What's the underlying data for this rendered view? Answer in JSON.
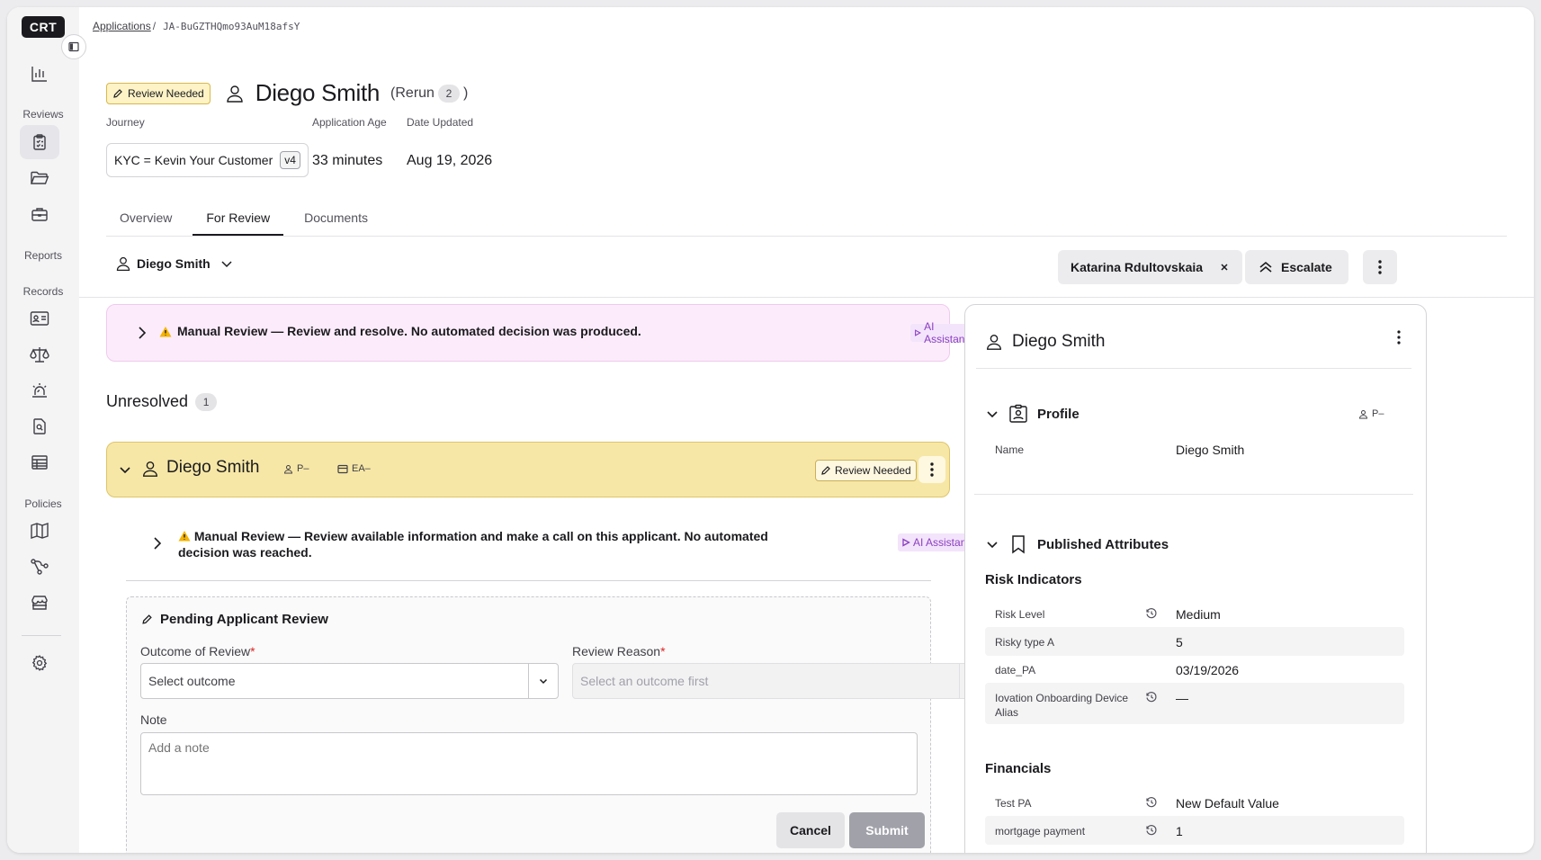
{
  "sidebar": {
    "logo": "CRT",
    "sections": {
      "reviews": "Reviews",
      "reports": "Reports",
      "records": "Records",
      "policies": "Policies"
    }
  },
  "breadcrumb": {
    "root": "Applications",
    "separator": "/",
    "id": "JA-BuGZTHQmo93AuM18afsY"
  },
  "header": {
    "status": "Review Needed",
    "name": "Diego Smith",
    "rerun_label": "(Rerun",
    "rerun_count": "2",
    "rerun_close": ")",
    "journey_label": "Journey",
    "journey_value": "KYC = Kevin Your Customer",
    "journey_version": "v4",
    "age_label": "Application Age",
    "age_value": "33 minutes",
    "updated_label": "Date Updated",
    "updated_value": "Aug 19, 2026"
  },
  "tabs": [
    "Overview",
    "For Review",
    "Documents"
  ],
  "toolbar": {
    "person": "Diego Smith",
    "assignee": "Katarina Rdultovskaia",
    "escalate": "Escalate"
  },
  "banner": {
    "text": "Manual Review — Review and resolve. No automated decision was produced.",
    "ai": "AI Assistant"
  },
  "unresolved": {
    "label": "Unresolved",
    "count": "1"
  },
  "card": {
    "name": "Diego Smith",
    "tag_person": "P–",
    "tag_entity": "EA–",
    "status": "Review Needed",
    "banner": "Manual Review — Review available information and make a call on this applicant. No automated decision was reached.",
    "ai": "AI Assistant"
  },
  "pending": {
    "title": "Pending Applicant Review",
    "outcome_label": "Outcome of Review",
    "outcome_placeholder": "Select outcome",
    "reason_label": "Review Reason",
    "reason_placeholder": "Select an outcome first",
    "required_mark": "*",
    "note_label": "Note",
    "note_placeholder": "Add a note",
    "cancel": "Cancel",
    "submit": "Submit"
  },
  "panel": {
    "name": "Diego Smith",
    "profile_title": "Profile",
    "profile_tag": "P–",
    "profile_rows": [
      {
        "label": "Name",
        "value": "Diego Smith"
      }
    ],
    "published_title": "Published Attributes",
    "risk_title": "Risk Indicators",
    "risk_rows": [
      {
        "label": "Risk Level",
        "value": "Medium"
      },
      {
        "label": "Risky type A",
        "value": "5"
      },
      {
        "label": "date_PA",
        "value": "03/19/2026"
      },
      {
        "label": "Iovation Onboarding Device Alias",
        "value": "—"
      }
    ],
    "financials_title": "Financials",
    "financial_rows": [
      {
        "label": "Test PA",
        "value": "New Default Value"
      },
      {
        "label": "mortgage payment",
        "value": "1"
      }
    ]
  }
}
